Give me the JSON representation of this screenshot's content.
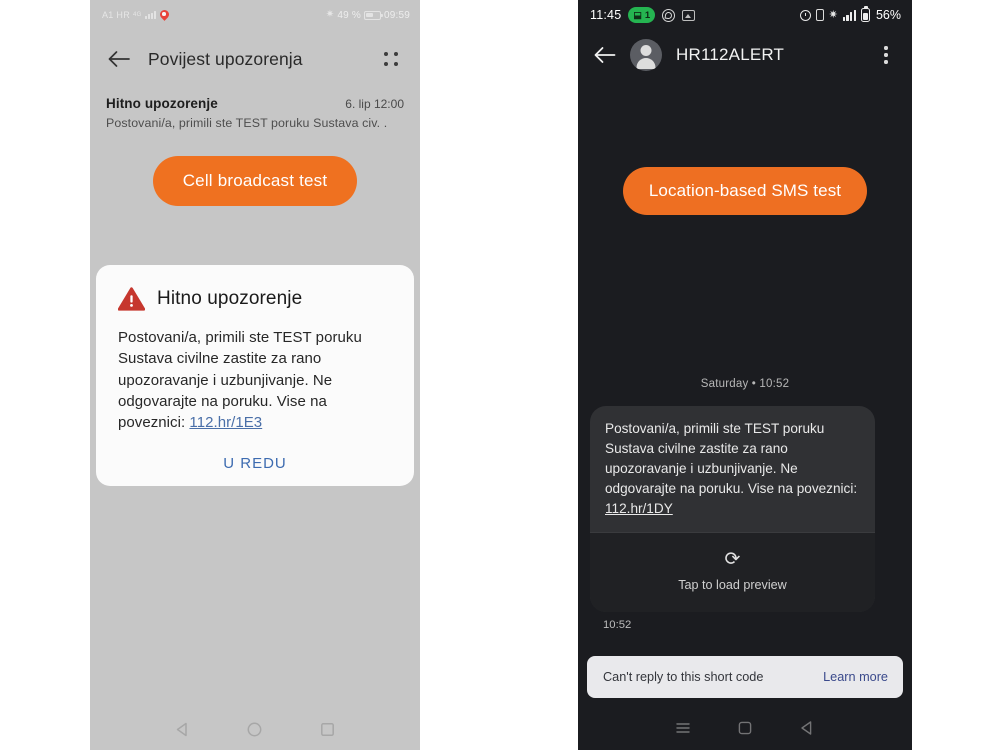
{
  "left_phone": {
    "status_bar": {
      "carrier": "A1 HR",
      "network_type": "4G",
      "battery_percent": "49 %",
      "clock": "09:59",
      "icons": [
        "signal-bars-icon",
        "location-pin-icon",
        "bluetooth-icon",
        "battery-icon"
      ]
    },
    "app_bar": {
      "back_label": "back-arrow",
      "title": "Povijest upozorenja",
      "menu_label": "more-options"
    },
    "alert_list_item": {
      "title": "Hitno upozorenje",
      "timestamp": "6. lip 12:00",
      "preview": "Postovani/a, primili ste TEST poruku Sustava civ. ."
    },
    "cta_label": "Cell broadcast test",
    "dialog": {
      "title": "Hitno upozorenje",
      "body_before_link": "Postovani/a, primili ste TEST poruku Sustava civilne zastite za rano upozoravanje i uzbunjivanje. Ne odgovarajte na poruku. Vise na poveznici: ",
      "link": "112.hr/1E3",
      "ok_label": "U REDU"
    },
    "nav_bar": {
      "back": "nav-back-triangle",
      "home": "nav-home-circle",
      "recents": "nav-recents-square"
    },
    "colors": {
      "background": "#c6c6c6",
      "accent": "#ef7120",
      "dialog_background": "#fbfbfb",
      "link": "#4a6fa8",
      "warning_triangle": "#c6372e"
    }
  },
  "right_phone": {
    "status_bar": {
      "clock": "11:45",
      "badge_count": "1",
      "battery_percent": "56%",
      "icons": [
        "data-saver-badge-icon",
        "whatsapp-icon",
        "photos-icon",
        "alarm-icon",
        "vibrate-icon",
        "bluetooth-icon",
        "signal-bars-icon",
        "battery-icon"
      ]
    },
    "app_bar": {
      "back_label": "back-arrow",
      "avatar_label": "contact-avatar",
      "title": "HR112ALERT",
      "menu_label": "more-options"
    },
    "cta_label": "Location-based SMS test",
    "day_stamp": "Saturday • 10:52",
    "message": {
      "body_before_link": "Postovani/a, primili ste TEST poruku Sustava civilne zastite za rano upozoravanje i uzbunjivanje. Ne odgovarajte na poruku. Vise na poveznici: ",
      "link": "112.hr/1DY",
      "preview_label": "Tap to load preview",
      "preview_icon": "refresh-icon",
      "time": "10:52"
    },
    "short_code_bar": {
      "text": "Can't reply to this short code",
      "link": "Learn more"
    },
    "nav_bar": {
      "recents": "nav-recents-lines",
      "home": "nav-home-square",
      "back": "nav-back-triangle"
    },
    "colors": {
      "background": "#1b1c20",
      "accent": "#ee6f22",
      "bubble": "#303134",
      "preview_panel": "#202124",
      "short_code_bg": "#e9e9ec",
      "short_code_link": "#3b4a8c",
      "badge_green": "#25b451"
    }
  }
}
